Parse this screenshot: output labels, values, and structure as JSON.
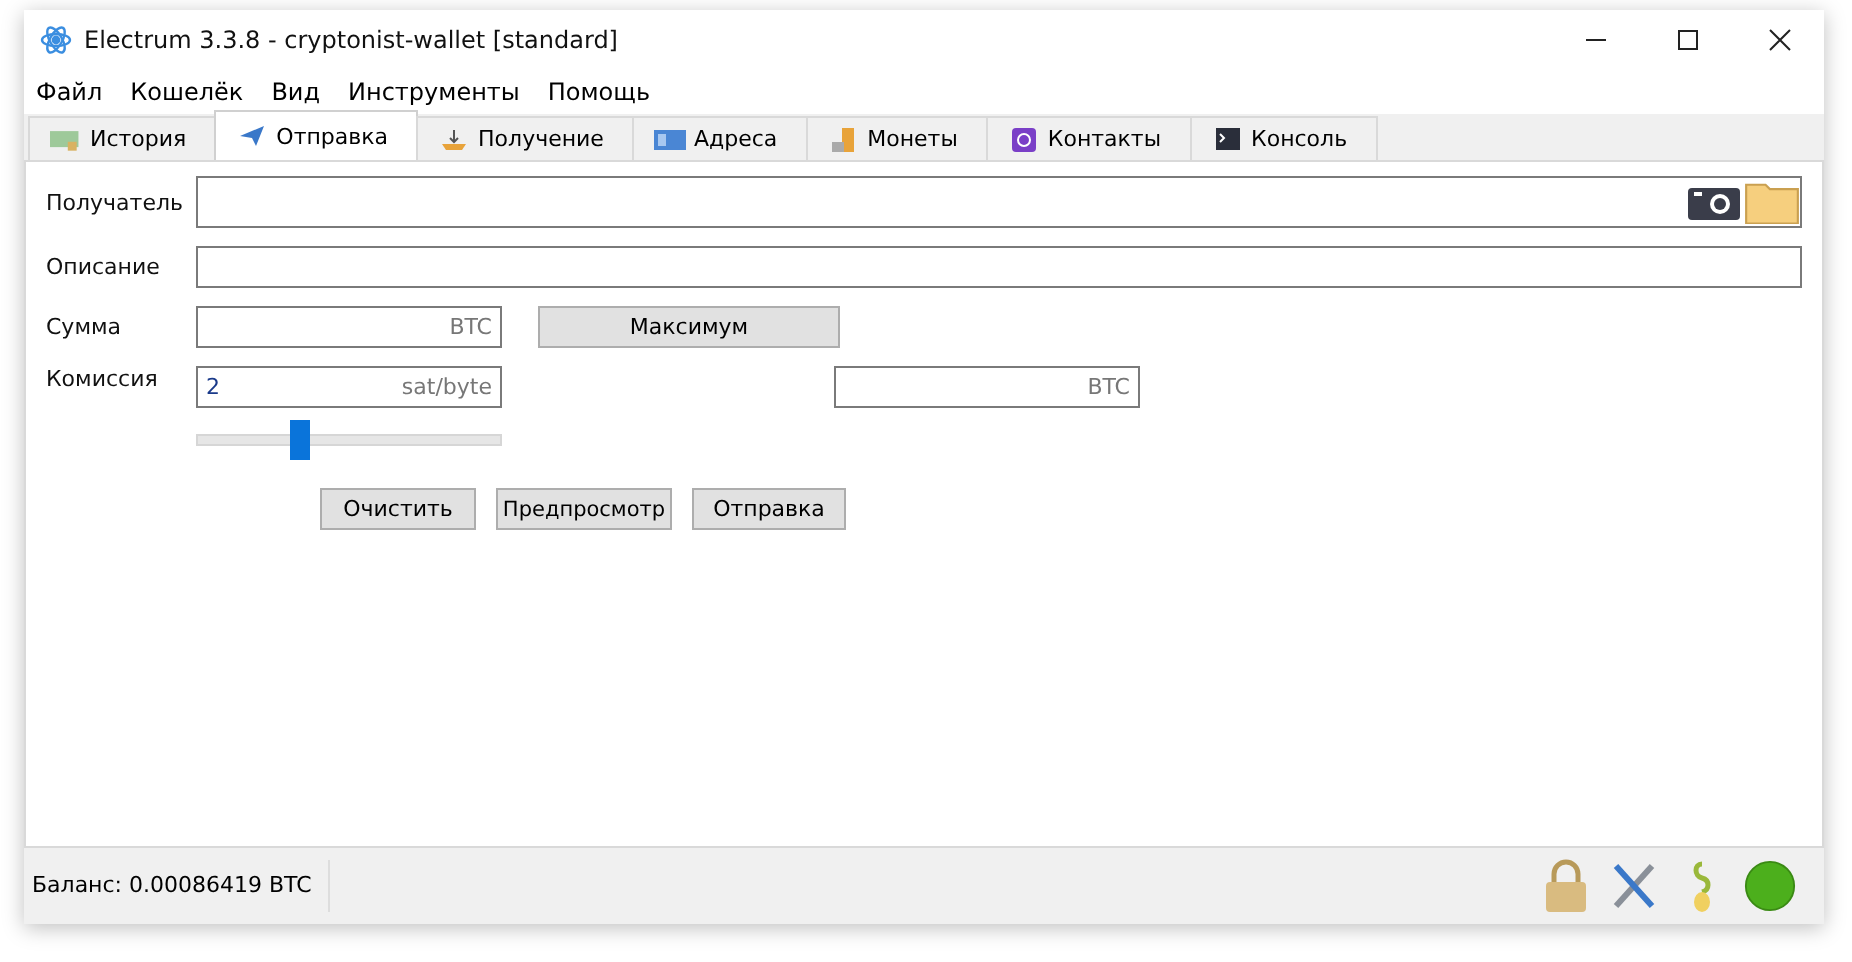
{
  "window": {
    "title": "Electrum 3.3.8  -  cryptonist-wallet  [standard]"
  },
  "menu": [
    "Файл",
    "Кошелёк",
    "Вид",
    "Инструменты",
    "Помощь"
  ],
  "tabs": [
    {
      "label": "История",
      "kind": "history",
      "selected": false
    },
    {
      "label": "Отправка",
      "kind": "send",
      "selected": true
    },
    {
      "label": "Получение",
      "kind": "receive",
      "selected": false
    },
    {
      "label": "Адреса",
      "kind": "addresses",
      "selected": false
    },
    {
      "label": "Монеты",
      "kind": "coins",
      "selected": false
    },
    {
      "label": "Контакты",
      "kind": "contacts",
      "selected": false
    },
    {
      "label": "Консоль",
      "kind": "console",
      "selected": false
    }
  ],
  "form": {
    "recipient_label": "Получатель",
    "description_label": "Описание",
    "amount_label": "Сумма",
    "amount_unit": "BTC",
    "max_button": "Максимум",
    "fee_label": "Комиссия",
    "fee_value": "2",
    "fee_unit": "sat/byte",
    "fee_btc_unit": "BTC",
    "fee_slider": {
      "level": 0.34
    }
  },
  "buttons": [
    "Очистить",
    "Предпросмотр",
    "Отправка"
  ],
  "status_bar": {
    "balance": "Баланс: 0.00086419 BTC"
  }
}
